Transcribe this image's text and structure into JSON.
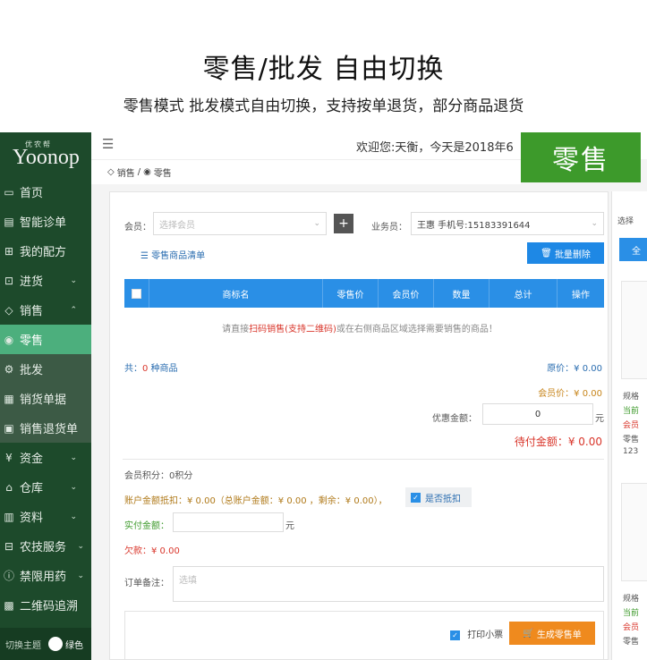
{
  "hero": {
    "title": "零售/批发 自由切换",
    "subtitle": "零售模式 批发模式自由切换，支持按单退货，部分商品退货"
  },
  "sidebar": {
    "logo_top": "优农帮",
    "logo_main": "Yoonop",
    "items": [
      {
        "label": "首页",
        "icon": "monitor-icon"
      },
      {
        "label": "智能诊单",
        "icon": "document-icon"
      },
      {
        "label": "我的配方",
        "icon": "plus-box-icon"
      },
      {
        "label": "进货",
        "icon": "cart-icon",
        "arrow": "⌄"
      },
      {
        "label": "销售",
        "icon": "tag-icon",
        "arrow": "⌃"
      },
      {
        "label": "零售",
        "icon": "circle-icon"
      },
      {
        "label": "批发",
        "icon": "gear-icon"
      },
      {
        "label": "销货单据",
        "icon": "receipt-icon"
      },
      {
        "label": "销售退货单",
        "icon": "return-icon"
      },
      {
        "label": "资金",
        "icon": "money-icon",
        "arrow": "⌄"
      },
      {
        "label": "仓库",
        "icon": "home-icon",
        "arrow": "⌄"
      },
      {
        "label": "资料",
        "icon": "book-icon",
        "arrow": "⌄"
      },
      {
        "label": "农技服务",
        "icon": "service-icon",
        "arrow": "⌄"
      },
      {
        "label": "禁限用药",
        "icon": "warning-icon",
        "arrow": "⌄"
      },
      {
        "label": "二维码追溯",
        "icon": "qrcode-icon"
      }
    ],
    "footer_label": "切换主题",
    "theme_label": "绿色"
  },
  "topbar": {
    "welcome": "欢迎您:天衡，今天是2018年6",
    "banner": "零售"
  },
  "breadcrumb": {
    "parent": "销售",
    "separator": "/",
    "current": "零售"
  },
  "form": {
    "member_label": "会员：",
    "member_placeholder": "选择会员",
    "plus": "+",
    "salesperson_label": "业务员：",
    "salesperson_value": "王惠 手机号:15183391644",
    "list_link": "零售商品清单",
    "batch_delete": "批量删除"
  },
  "table": {
    "headers": [
      "商标名",
      "零售价",
      "会员价",
      "数量",
      "总计",
      "操作"
    ],
    "empty_tip_pre": "请直接",
    "empty_tip_highlight": "扫码销售(支持二维码)",
    "empty_tip_post": "或在右侧商品区域选择需要销售的商品！"
  },
  "summary": {
    "count_pre": "共：",
    "count_num": "0",
    "count_post": " 种商品",
    "original_price": "原价：¥ 0.00",
    "member_price": "会员价：¥ 0.00",
    "discount_label": "优惠金额：",
    "discount_value": "0",
    "discount_unit": "元",
    "payable": "待付金额：¥ 0.00"
  },
  "account": {
    "points": "会员积分：0积分",
    "deduct": "账户金额抵扣：¥ 0.00（总账户金额：¥ 0.00 ，剩余：¥ 0.00），",
    "deduct_toggle": "是否抵扣",
    "paid_label": "实付金额：",
    "paid_unit": "元",
    "owed": "欠款：¥ 0.00",
    "remark_label": "订单备注：",
    "remark_placeholder": "选填",
    "print_label": "打印小票",
    "generate": "生成零售单"
  },
  "right_panel": {
    "label": "选择",
    "button": "全",
    "card1_lines": [
      "规格",
      "当前",
      "会员",
      "零售",
      "123"
    ],
    "card2_lines": [
      "规格",
      "当前",
      "会员",
      "零售"
    ]
  }
}
